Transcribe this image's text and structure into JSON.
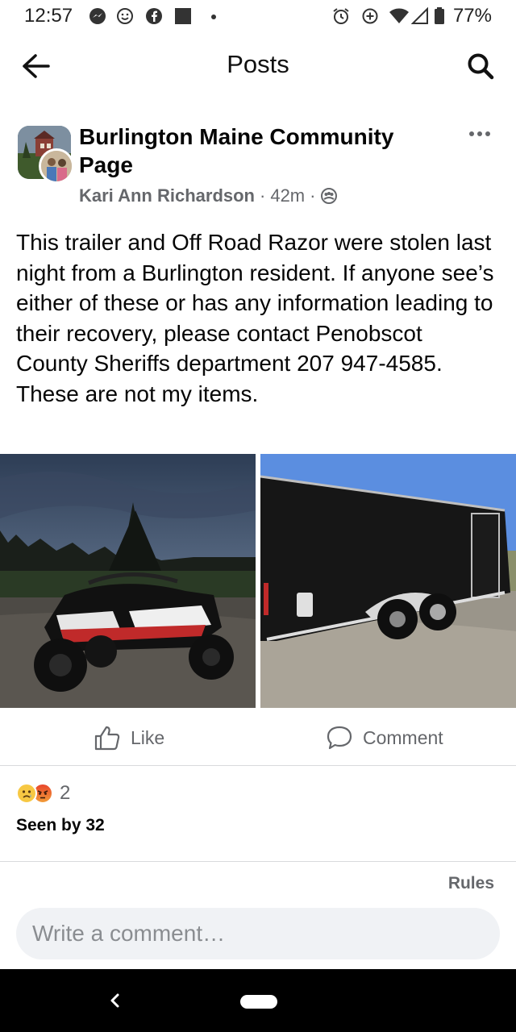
{
  "status_bar": {
    "time": "12:57",
    "battery": "77%",
    "left_icons": [
      "messenger-icon",
      "smiley-icon",
      "facebook-icon",
      "square-icon",
      "dot-icon"
    ],
    "right_icons": [
      "alarm-icon",
      "data-saver-icon",
      "wifi-icon",
      "signal-icon",
      "battery-icon"
    ]
  },
  "header": {
    "title": "Posts",
    "back_icon": "arrow-left-icon",
    "search_icon": "search-icon"
  },
  "post": {
    "group_name": "Burlington Maine Community Page",
    "author": "Kari Ann Richardson",
    "time": "42m",
    "separator": "·",
    "privacy_icon": "group-privacy-icon",
    "text": "This trailer and Off Road Razor were stolen last night from a Burlington resident.  If anyone see’s either of these or has any information leading to their recovery, please contact Penobscot County Sheriffs department 207 947-4585.   These are not my items.",
    "photos": [
      {
        "icon": "photo-off-road-utv"
      },
      {
        "icon": "photo-enclosed-trailer"
      }
    ]
  },
  "actions": {
    "like_label": "Like",
    "comment_label": "Comment"
  },
  "engagement": {
    "reaction_count": "2",
    "seen_by": "Seen by 32",
    "reactions": [
      "sad-reaction-icon",
      "angry-reaction-icon"
    ]
  },
  "rules_label": "Rules",
  "comment_input": {
    "placeholder": "Write a comment…"
  },
  "colors": {
    "text_primary": "#050505",
    "text_secondary": "#65676b",
    "input_bg": "#f0f2f5",
    "nav_bar": "#000000"
  }
}
